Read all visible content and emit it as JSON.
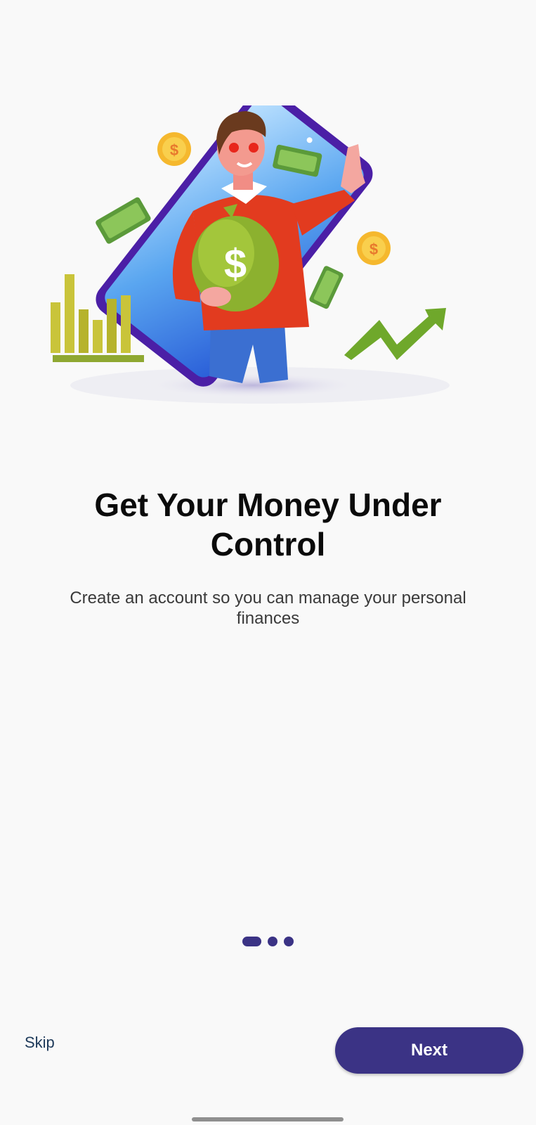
{
  "onboarding": {
    "title": "Get Your Money Under Control",
    "subtitle": "Create an account so you can manage your personal finances",
    "page_indicator": {
      "total": 3,
      "current": 1
    },
    "skip_label": "Skip",
    "next_label": "Next"
  },
  "illustration": {
    "name": "man-with-money-bag-illustration",
    "icons": [
      "phone-icon",
      "money-bag-icon",
      "coin-icon",
      "banknote-icon",
      "bar-chart-icon",
      "trend-arrow-icon"
    ]
  },
  "colors": {
    "primary": "#3b3385",
    "background": "#f9f9f9",
    "title": "#0b0b0b",
    "subtitle": "#3a3a3a",
    "skip": "#1e3a5a"
  }
}
